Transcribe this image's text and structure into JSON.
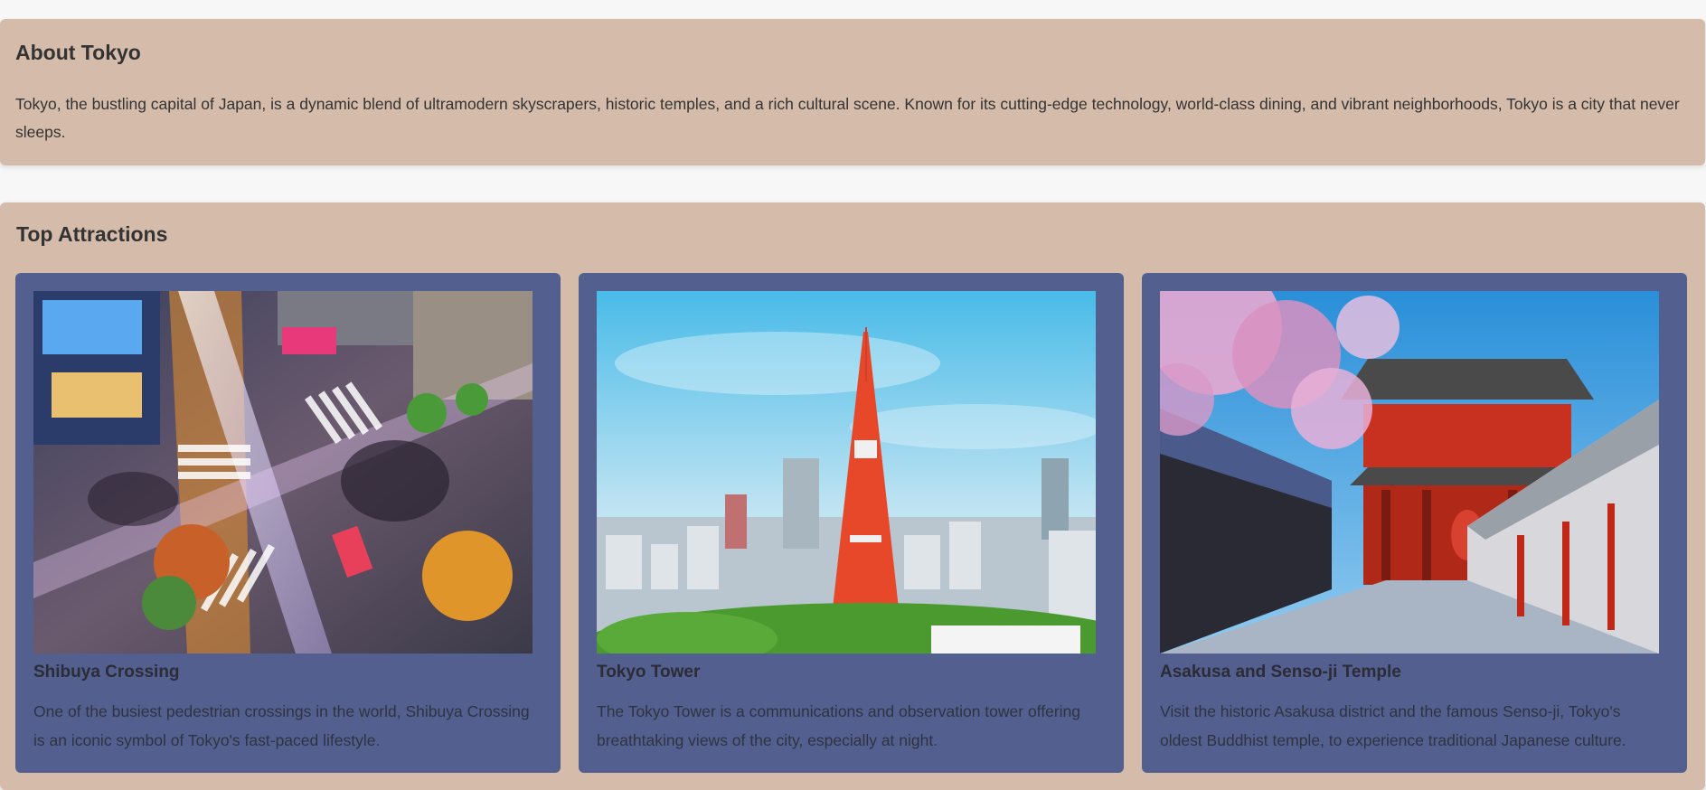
{
  "about": {
    "title": "About Tokyo",
    "text": "Tokyo, the bustling capital of Japan, is a dynamic blend of ultramodern skyscrapers, historic temples, and a rich cultural scene. Known for its cutting-edge technology, world-class dining, and vibrant neighborhoods, Tokyo is a city that never sleeps."
  },
  "attractions": {
    "title": "Top Attractions",
    "cards": [
      {
        "title": "Shibuya Crossing",
        "description": "One of the busiest pedestrian crossings in the world, Shibuya Crossing is an iconic symbol of Tokyo's fast-paced lifestyle.",
        "image": "shibuya-crossing-photo"
      },
      {
        "title": "Tokyo Tower",
        "description": "The Tokyo Tower is a communications and observation tower offering breathtaking views of the city, especially at night.",
        "image": "tokyo-tower-photo"
      },
      {
        "title": "Asakusa and Senso-ji Temple",
        "description": "Visit the historic Asakusa district and the famous Senso-ji, Tokyo's oldest Buddhist temple, to experience traditional Japanese culture.",
        "image": "sensoji-temple-photo"
      }
    ]
  },
  "colors": {
    "section_bg": "#d5bbaa",
    "card_bg": "#53608f",
    "page_bg": "#f7f7f7"
  }
}
